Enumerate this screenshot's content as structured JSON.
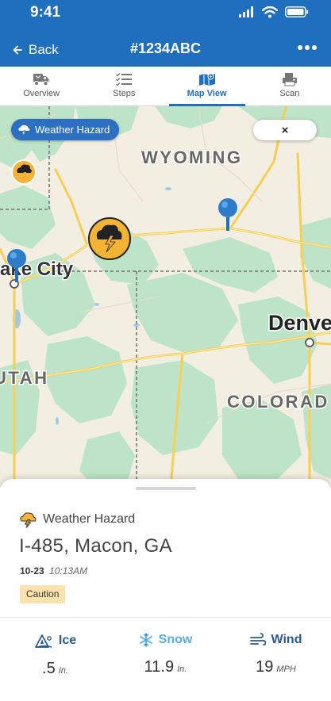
{
  "status_bar": {
    "time": "9:41"
  },
  "nav": {
    "back_label": "Back",
    "title": "#1234ABC"
  },
  "tabs": [
    {
      "label": "Overview",
      "icon": "truck-icon",
      "active": false
    },
    {
      "label": "Steps",
      "icon": "checklist-icon",
      "active": false
    },
    {
      "label": "Map View",
      "icon": "map-icon",
      "active": true
    },
    {
      "label": "Scan",
      "icon": "scanner-icon",
      "active": false
    }
  ],
  "map": {
    "hazard_chip_label": "Weather Hazard",
    "close_label": "×",
    "labels": {
      "wyoming": "WYOMING",
      "salt_lake": "ake City",
      "denver": "Denve",
      "utah": "UTAH",
      "colorado": "COLORAD"
    }
  },
  "detail": {
    "hazard_type": "Weather Hazard",
    "location": "I-485, Macon, GA",
    "date": "10-23",
    "time": "10:13AM",
    "badge": "Caution"
  },
  "metrics": [
    {
      "label": "Ice",
      "value": ".5",
      "unit": "In.",
      "color": "#2a5b8c",
      "icon": "ice-hazard-icon"
    },
    {
      "label": "Snow",
      "value": "11.9",
      "unit": "In.",
      "color": "#56aee6",
      "icon": "snowflake-icon"
    },
    {
      "label": "Wind",
      "value": "19",
      "unit": "MPH",
      "color": "#2a5b8c",
      "icon": "wind-icon"
    }
  ],
  "colors": {
    "brand_blue": "#1f6fbf",
    "hazard_yellow": "#f5b335",
    "caution_badge": "#fde1ae",
    "map_land": "#f3eee2",
    "map_green": "#bde3c8",
    "map_road": "#f7cf55"
  }
}
